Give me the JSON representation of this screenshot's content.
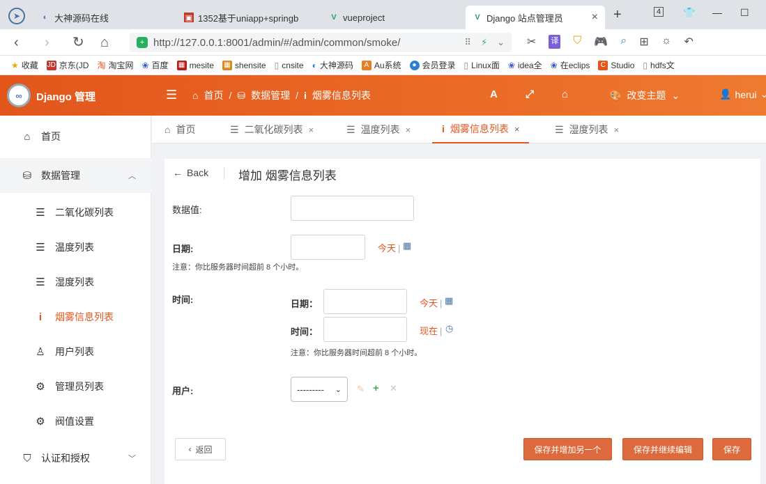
{
  "browser": {
    "tabs": [
      {
        "title": "大神源码在线"
      },
      {
        "title": "1352基于uniapp+springb"
      },
      {
        "title": "vueproject"
      },
      {
        "title": "Django 站点管理员"
      }
    ],
    "tab_counter": "4",
    "url": "http://127.0.0.1:8001/admin/#/admin/common/smoke/",
    "bookmarks": [
      "收藏",
      "京东(JD",
      "淘宝网",
      "百度",
      "mesite",
      "shensite",
      "cnsite",
      "大神源码",
      "Au系统",
      "会员登录",
      "Linux面",
      "idea全",
      "在eclips",
      "Studio",
      "hdfs文"
    ],
    "translate_label": "译"
  },
  "header": {
    "brand": "Django 管理",
    "breadcrumb": [
      "首页",
      "数据管理",
      "烟雾信息列表"
    ],
    "font_button": "A",
    "theme_label": "改变主题",
    "user": "herui",
    "accent": "#e2561c"
  },
  "sidebar": {
    "items": [
      {
        "label": "首页",
        "icon": "home-icon"
      },
      {
        "label": "数据管理",
        "icon": "database-icon"
      },
      {
        "label": "二氧化碳列表",
        "icon": "list-icon"
      },
      {
        "label": "温度列表",
        "icon": "list-icon"
      },
      {
        "label": "湿度列表",
        "icon": "list-icon"
      },
      {
        "label": "烟雾信息列表",
        "icon": "info-icon"
      },
      {
        "label": "用户列表",
        "icon": "user-icon"
      },
      {
        "label": "管理员列表",
        "icon": "gear-icon"
      },
      {
        "label": "阀值设置",
        "icon": "gear-icon"
      },
      {
        "label": "认证和授权",
        "icon": "shield-icon"
      }
    ]
  },
  "tabs": [
    {
      "label": "首页"
    },
    {
      "label": "二氧化碳列表"
    },
    {
      "label": "温度列表"
    },
    {
      "label": "烟雾信息列表"
    },
    {
      "label": "湿度列表"
    }
  ],
  "form": {
    "back_label": "Back",
    "title": "增加 烟雾信息列表",
    "data_value_label": "数据值:",
    "data_value": "",
    "date_label": "日期:",
    "today_link": "今天",
    "tz_note": "注意：你比服务器时间超前 8 个小时。",
    "time_label": "时间:",
    "sub_date_label": "日期：",
    "sub_time_label": "时间：",
    "now_link": "现在",
    "user_label": "用户:",
    "user_select": "---------",
    "buttons": {
      "back": "返回",
      "save_add": "保存并增加另一个",
      "save_continue": "保存并继续编辑",
      "save": "保存"
    }
  }
}
